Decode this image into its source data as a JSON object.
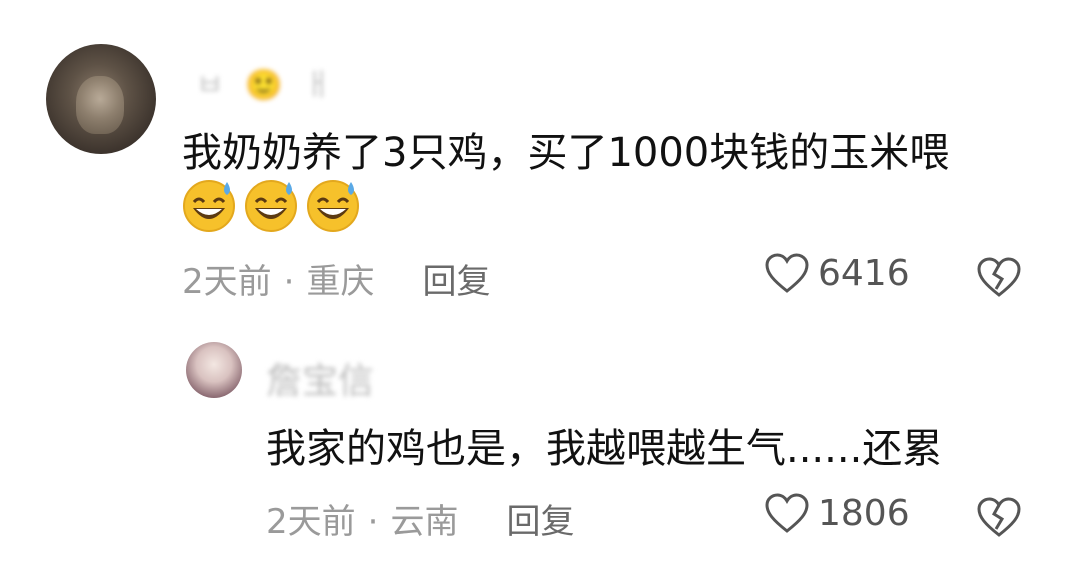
{
  "comments": [
    {
      "username": "ㅂ 🙂 ㅐ",
      "text": "我奶奶养了3只鸡，买了1000块钱的玉米喂",
      "emojis": [
        "grinning-sweat-emoji",
        "grinning-sweat-emoji",
        "grinning-sweat-emoji"
      ],
      "time": "2天前",
      "location": "重庆",
      "reply_label": "回复",
      "likes": "6416"
    },
    {
      "username": "詹宝信",
      "text": "我家的鸡也是，我越喂越生气......还累",
      "time": "2天前",
      "location": "云南",
      "reply_label": "回复",
      "likes": "1806"
    }
  ],
  "separator": "·",
  "icons": {
    "like": "heart-outline-icon",
    "dislike": "broken-heart-icon"
  },
  "colors": {
    "text": "#111111",
    "meta": "#9a9a9a",
    "emoji_face": "#f6c12b",
    "emoji_sweat": "#5aa9e6"
  }
}
